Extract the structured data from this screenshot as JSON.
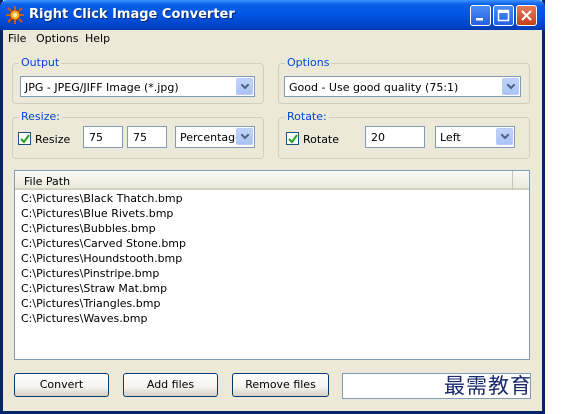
{
  "window": {
    "title": "Right Click Image Converter"
  },
  "menu": [
    "File",
    "Options",
    "Help"
  ],
  "output": {
    "label": "Output",
    "format": "JPG - JPEG/JIFF Image (*.jpg)"
  },
  "options": {
    "label": "Options",
    "quality": "Good - Use good quality (75:1)"
  },
  "resize": {
    "label": "Resize:",
    "checkbox_label": "Resize",
    "checked": true,
    "width": "75",
    "height": "75",
    "unit": "Percentage"
  },
  "rotate": {
    "label": "Rotate:",
    "checkbox_label": "Rotate",
    "checked": true,
    "degrees": "20",
    "direction": "Left"
  },
  "files": {
    "column": "File Path",
    "rows": [
      "C:\\Pictures\\Black Thatch.bmp",
      "C:\\Pictures\\Blue Rivets.bmp",
      "C:\\Pictures\\Bubbles.bmp",
      "C:\\Pictures\\Carved Stone.bmp",
      "C:\\Pictures\\Houndstooth.bmp",
      "C:\\Pictures\\Pinstripe.bmp",
      "C:\\Pictures\\Straw Mat.bmp",
      "C:\\Pictures\\Triangles.bmp",
      "C:\\Pictures\\Waves.bmp"
    ]
  },
  "buttons": {
    "convert": "Convert",
    "add_files": "Add files",
    "remove_files": "Remove files"
  },
  "watermark": "最需教育"
}
